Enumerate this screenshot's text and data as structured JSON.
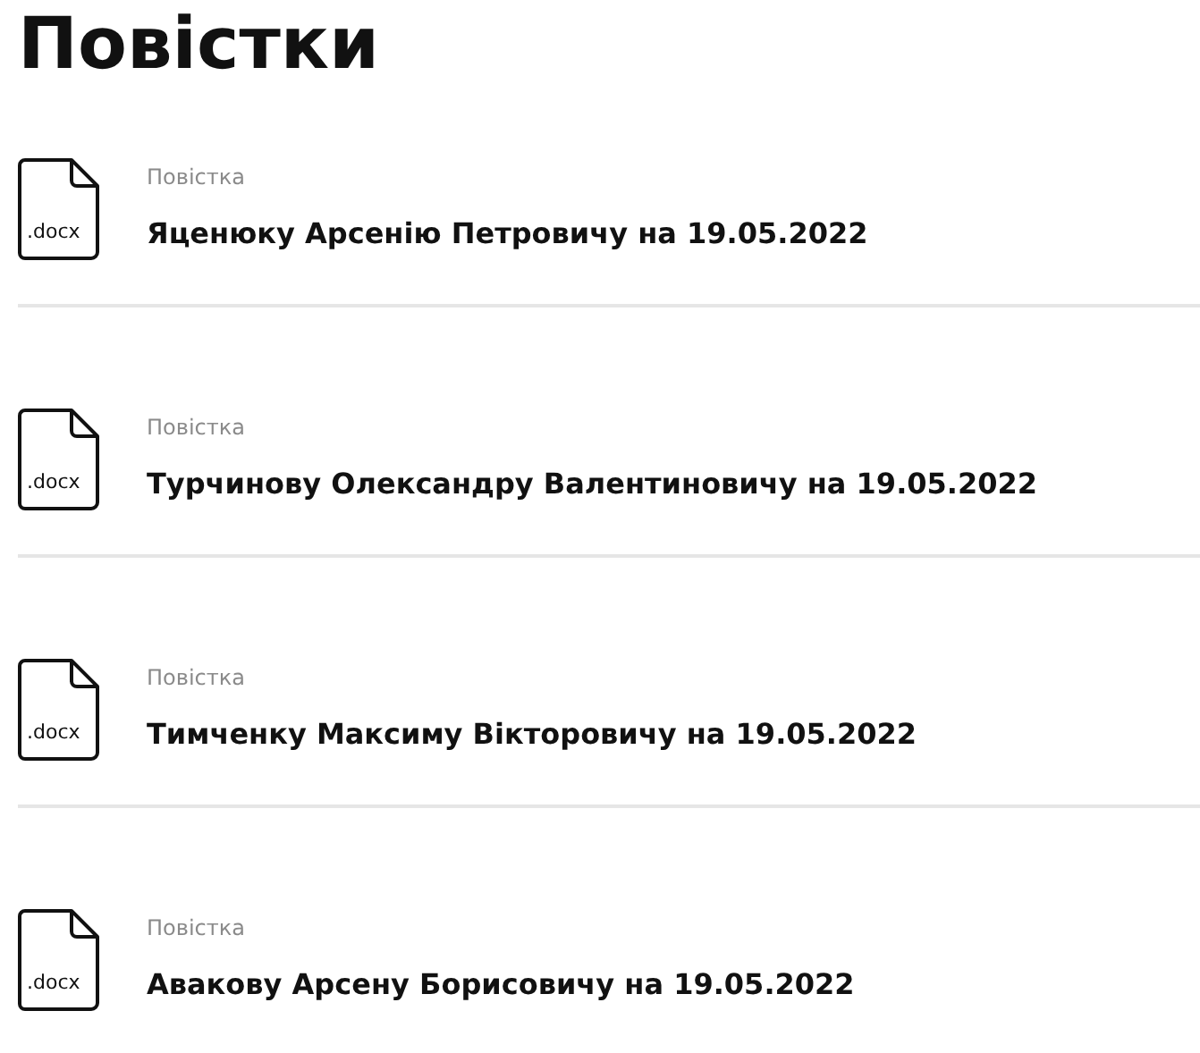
{
  "title": "Повістки",
  "items": [
    {
      "file_type": ".docx",
      "label": "Повістка",
      "name": "Яценюку Арсенію Петровичу на 19.05.2022"
    },
    {
      "file_type": ".docx",
      "label": "Повістка",
      "name": "Турчинову Олександру Валентиновичу на 19.05.2022"
    },
    {
      "file_type": ".docx",
      "label": "Повістка",
      "name": "Тимченку Максиму Вікторовичу на 19.05.2022"
    },
    {
      "file_type": ".docx",
      "label": "Повістка",
      "name": "Авакову Арсену Борисовичу на 19.05.2022"
    }
  ]
}
